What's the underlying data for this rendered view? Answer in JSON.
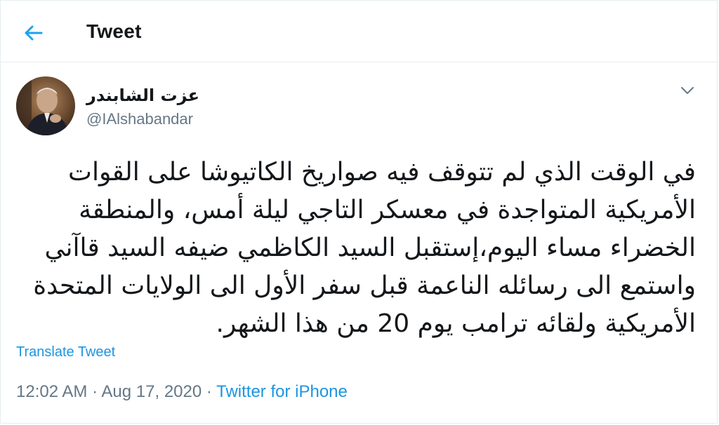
{
  "header": {
    "title": "Tweet",
    "back_icon": "arrow-left-icon"
  },
  "colors": {
    "accent": "#1da1f2",
    "link": "#1b95e0",
    "secondary_text": "#657786",
    "divider": "#e6ecf0"
  },
  "tweet": {
    "display_name": "عزت الشابندر",
    "handle": "@IAlshabandar",
    "menu_icon": "chevron-down-icon",
    "text": "في الوقت الذي لم تتوقف فيه صواريخ الكاتيوشا على القوات الأمريكية المتواجدة في معسكر التاجي ليلة أمس، والمنطقة الخضراء مساء اليوم،إستقبل السيد الكاظمي ضيفه السيد قاآني واستمع الى رسائله الناعمة قبل سفر الأول الى الولايات المتحدة الأمريكية ولقائه ترامب يوم 20 من هذا الشهر.",
    "translate_label": "Translate Tweet",
    "time": "12:02 AM",
    "date": "Aug 17, 2020",
    "separator": "·",
    "source": "Twitter for iPhone"
  }
}
